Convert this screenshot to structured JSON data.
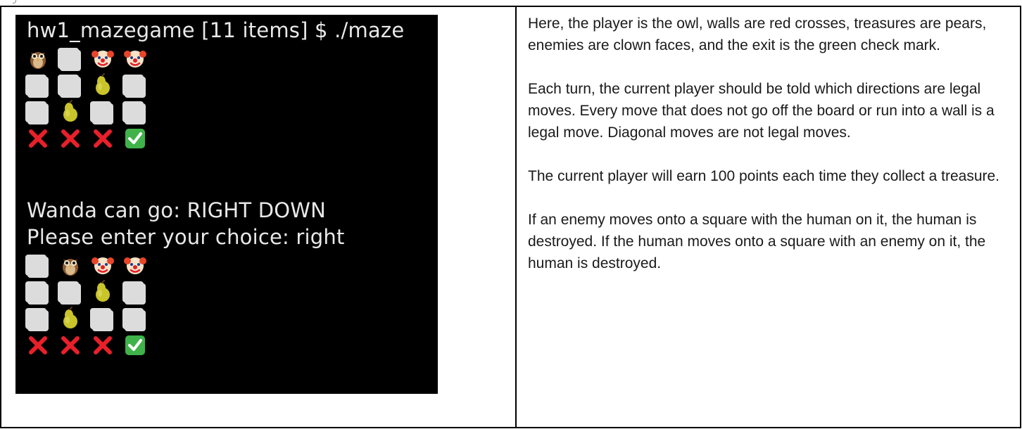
{
  "terminal": {
    "prompt_line": "hw1_mazegame [11 items] $ ./maze",
    "status_line": "Wanda can go: RIGHT DOWN",
    "input_line": "Please enter your choice: right",
    "board_before": [
      [
        "owl",
        "blank",
        "clown",
        "clown"
      ],
      [
        "blank",
        "blank",
        "pear",
        "blank"
      ],
      [
        "blank",
        "pear",
        "blank",
        "blank"
      ],
      [
        "wall",
        "wall",
        "wall",
        "exit"
      ]
    ],
    "board_after": [
      [
        "blank",
        "owl",
        "clown",
        "clown"
      ],
      [
        "blank",
        "blank",
        "pear",
        "blank"
      ],
      [
        "blank",
        "pear",
        "blank",
        "blank"
      ],
      [
        "wall",
        "wall",
        "wall",
        "exit"
      ]
    ]
  },
  "description": {
    "paragraphs": [
      "Here, the player is the owl, walls are red crosses, treasures are pears, enemies are clown faces, and the exit is the green check mark.",
      "Each turn, the current player should be told which directions are legal moves. Every move that does not go off the board or run into a wall is a legal move. Diagonal moves are not legal moves.",
      "The current player will earn 100 points each time they collect a treasure.",
      "If an enemy moves onto a square with the human on it, the human is destroyed. If the human moves onto a square with an enemy on it, the human is destroyed."
    ]
  },
  "colors": {
    "terminal_bg": "#000000",
    "terminal_text": "#e8e8e8",
    "wall_red": "#e8202a",
    "exit_green": "#3fb34a",
    "blank_tile": "#dcdcdc",
    "pear_yellow": "#c9c42a"
  }
}
